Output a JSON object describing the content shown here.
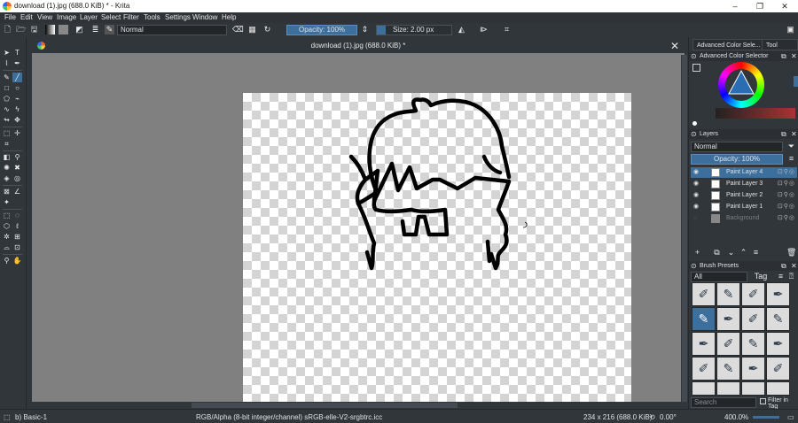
{
  "window": {
    "title": "download (1).jpg (688.0 KiB) * - Krita",
    "minimize": "–",
    "maximize": "❐",
    "close": "✕"
  },
  "menu": [
    "File",
    "Edit",
    "View",
    "Image",
    "Layer",
    "Select",
    "Filter",
    "Tools",
    "Settings",
    "Window",
    "Help"
  ],
  "toolbar": {
    "blend_mode": "Normal",
    "opacity": "Opacity: 100%",
    "size": "Size: 2.00 px"
  },
  "document": {
    "tab_title": "download (1).jpg (688.0 KiB) *",
    "tab_close": "✕"
  },
  "dock": {
    "tabs": [
      "Advanced Color Sele...",
      "Tool Opt..."
    ],
    "color_selector_title": "Advanced Color Selector",
    "layers_title": "Layers",
    "layer_blend": "Normal",
    "layer_opacity": "Opacity:  100%",
    "layers": [
      {
        "name": "Paint Layer 4",
        "active": true,
        "visible": true
      },
      {
        "name": "Paint Layer 3",
        "active": false,
        "visible": true
      },
      {
        "name": "Paint Layer 2",
        "active": false,
        "visible": true
      },
      {
        "name": "Paint Layer 1",
        "active": false,
        "visible": true
      },
      {
        "name": "Background",
        "active": false,
        "visible": false
      }
    ],
    "brush_presets_title": "Brush Presets",
    "brush_filter": "All",
    "brush_tag": "Tag",
    "search_placeholder": "Search",
    "filter_in_tag": "Filter in Tag"
  },
  "status": {
    "brush": "b) Basic-1",
    "color_profile": "RGB/Alpha (8-bit integer/channel)  sRGB-elle-V2-srgbtrc.icc",
    "dimensions": "234 x 216 (688.0 KiB)",
    "rotation": "0.00°",
    "zoom": "400.0%"
  },
  "colors": {
    "accent": "#3d6f9d",
    "background": "#31363b",
    "canvas": "#808080"
  }
}
